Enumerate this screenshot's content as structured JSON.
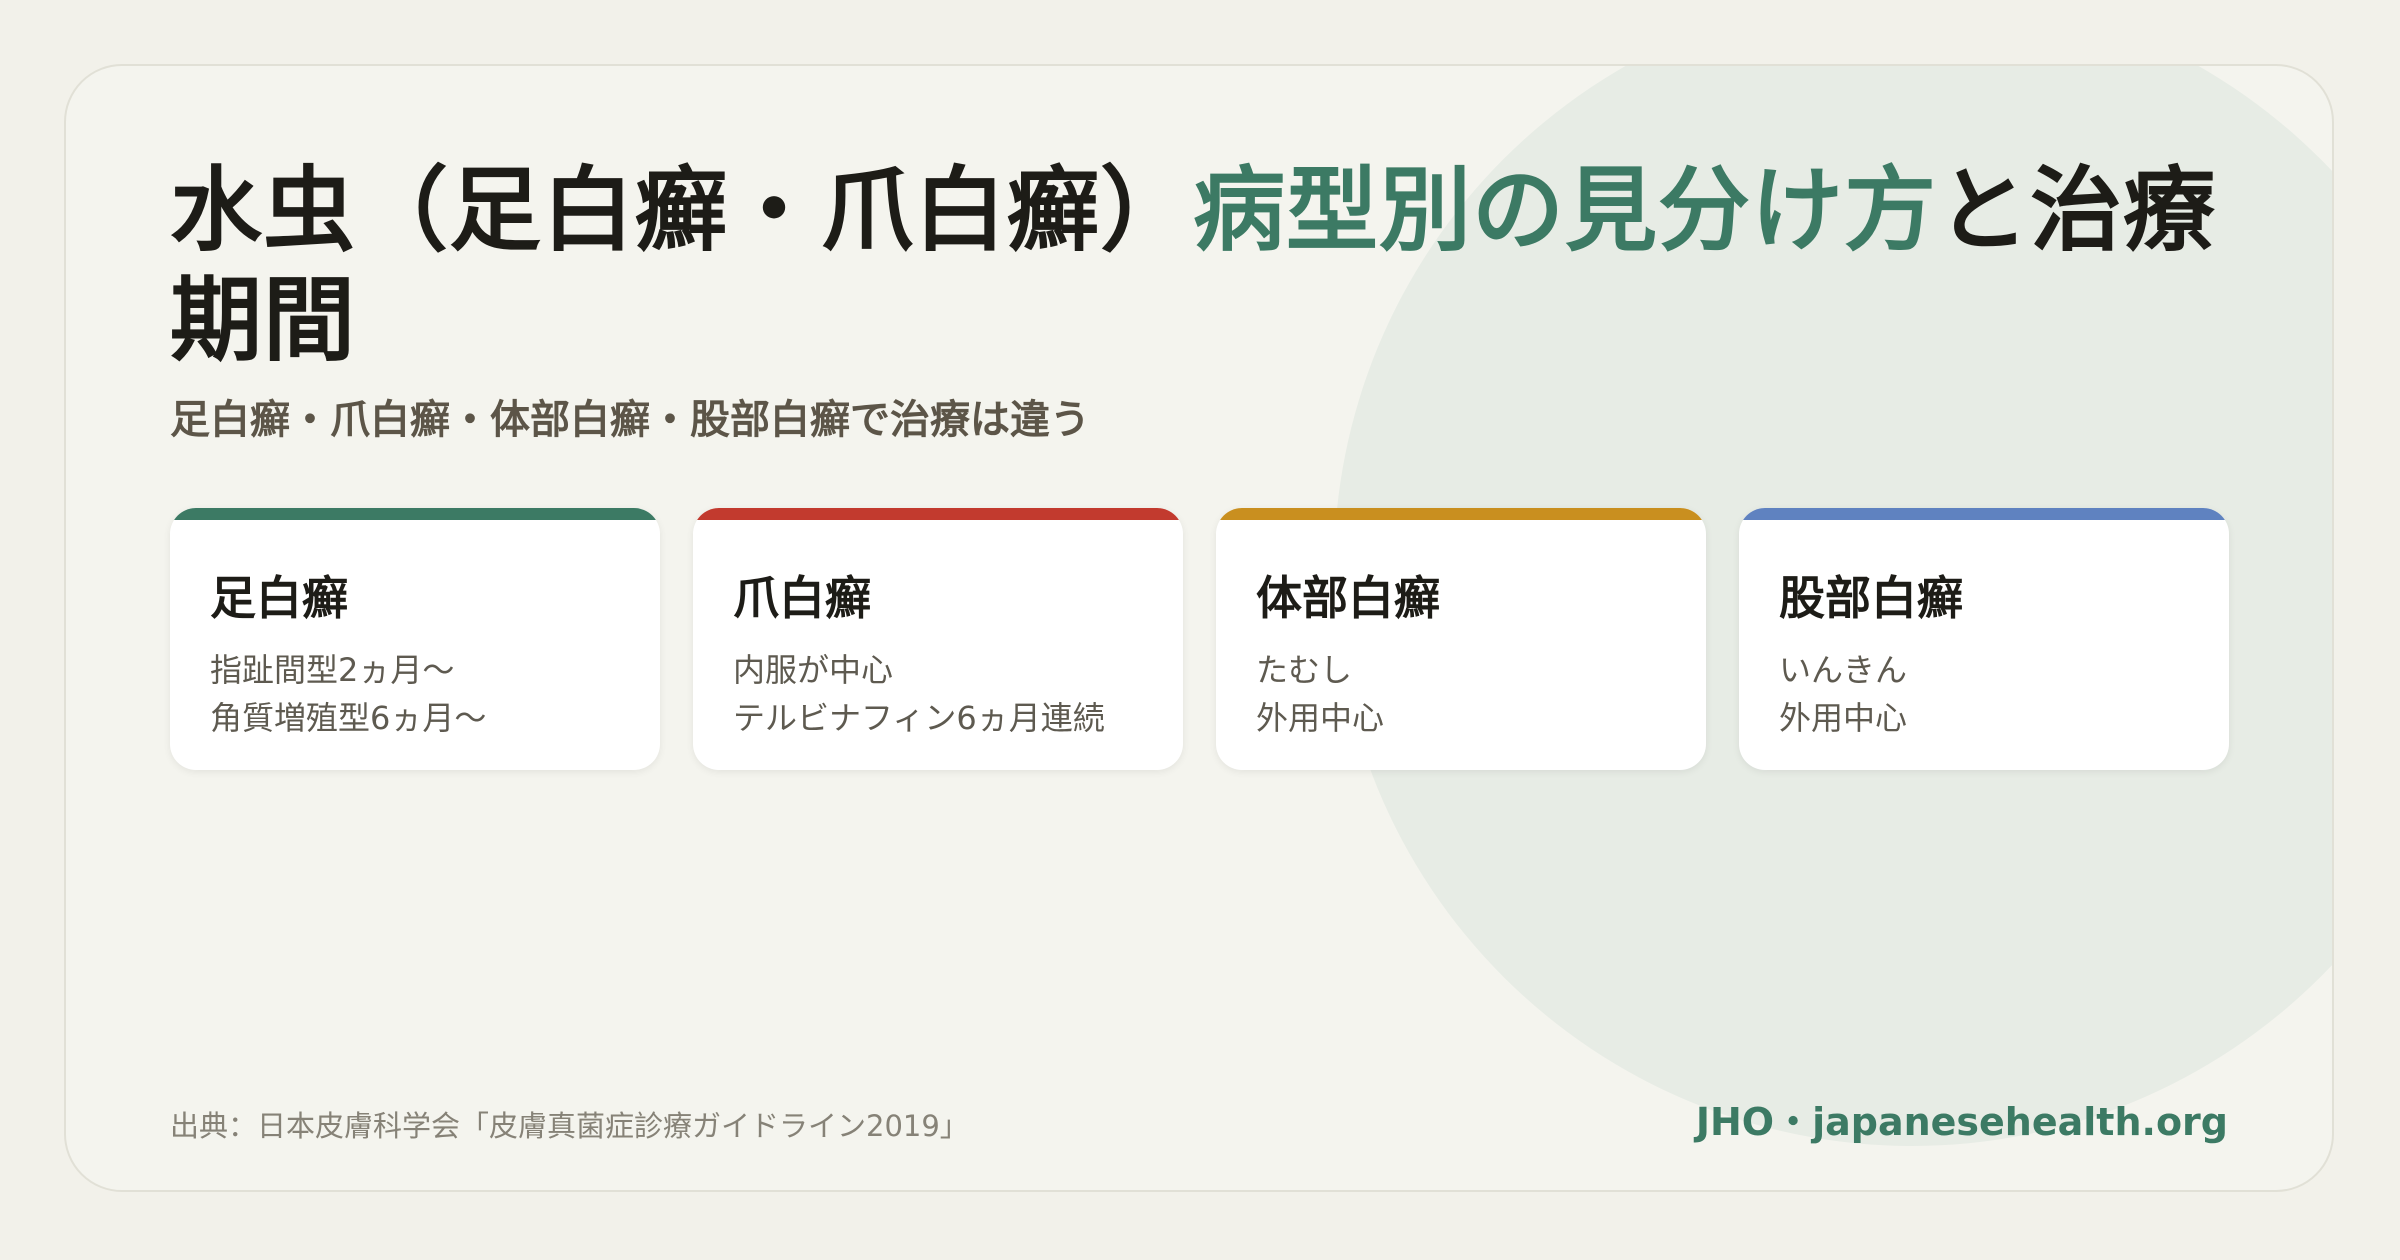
{
  "header": {
    "title_part1": "水虫（足白癬・爪白癬）",
    "title_accent": "病型別の見分け方",
    "title_part2": "と治療期間",
    "subtitle": "足白癬・爪白癬・体部白癬・股部白癬で治療は違う"
  },
  "cards": [
    {
      "title": "足白癬",
      "line1": "指趾間型2ヵ月〜",
      "line2": "角質増殖型6ヵ月〜",
      "color": "#3c7a64"
    },
    {
      "title": "爪白癬",
      "line1": "内服が中心",
      "line2": "テルビナフィン6ヵ月連続",
      "color": "#c23a2e"
    },
    {
      "title": "体部白癬",
      "line1": "たむし",
      "line2": "外用中心",
      "color": "#c98f1f"
    },
    {
      "title": "股部白癬",
      "line1": "いんきん",
      "line2": "外用中心",
      "color": "#5f82c0"
    }
  ],
  "footer": {
    "source": "出典：日本皮膚科学会「皮膚真菌症診療ガイドライン2019」",
    "brand": "JHO・japanesehealth.org"
  },
  "colors": {
    "accent": "#3c7a64",
    "background": "#f2f1ea"
  }
}
